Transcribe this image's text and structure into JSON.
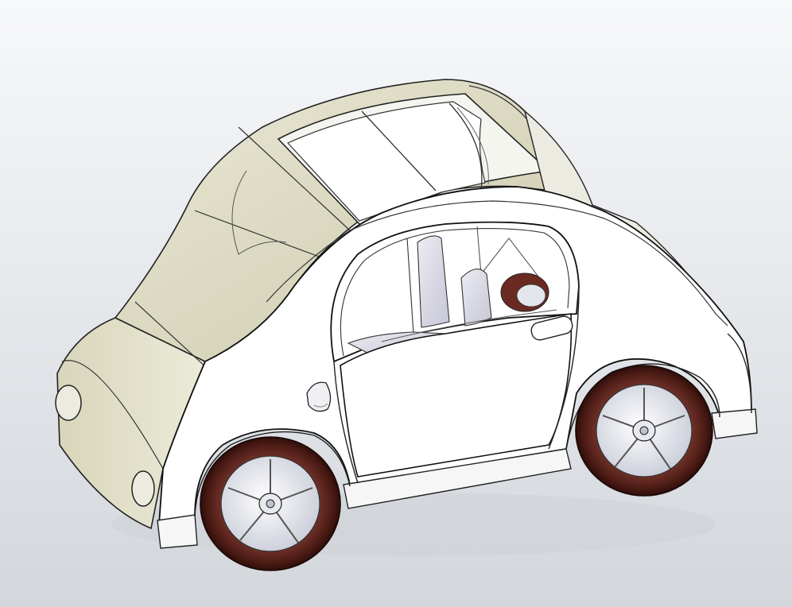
{
  "scene": {
    "subject": "car-3d-cad-model",
    "view": "isometric",
    "colors": {
      "background_top": "#f7f8fa",
      "background_bottom": "#d6d9de",
      "body_white": "#ffffff",
      "glass_tint": "#e6e4cf",
      "glass_tint_dark": "#cfcbb0",
      "tire": "#5a2620",
      "tire_dark": "#3a1410",
      "rim": "#dde0ea",
      "seat": "#dcdce8",
      "outline": "#1a1a1a"
    }
  }
}
